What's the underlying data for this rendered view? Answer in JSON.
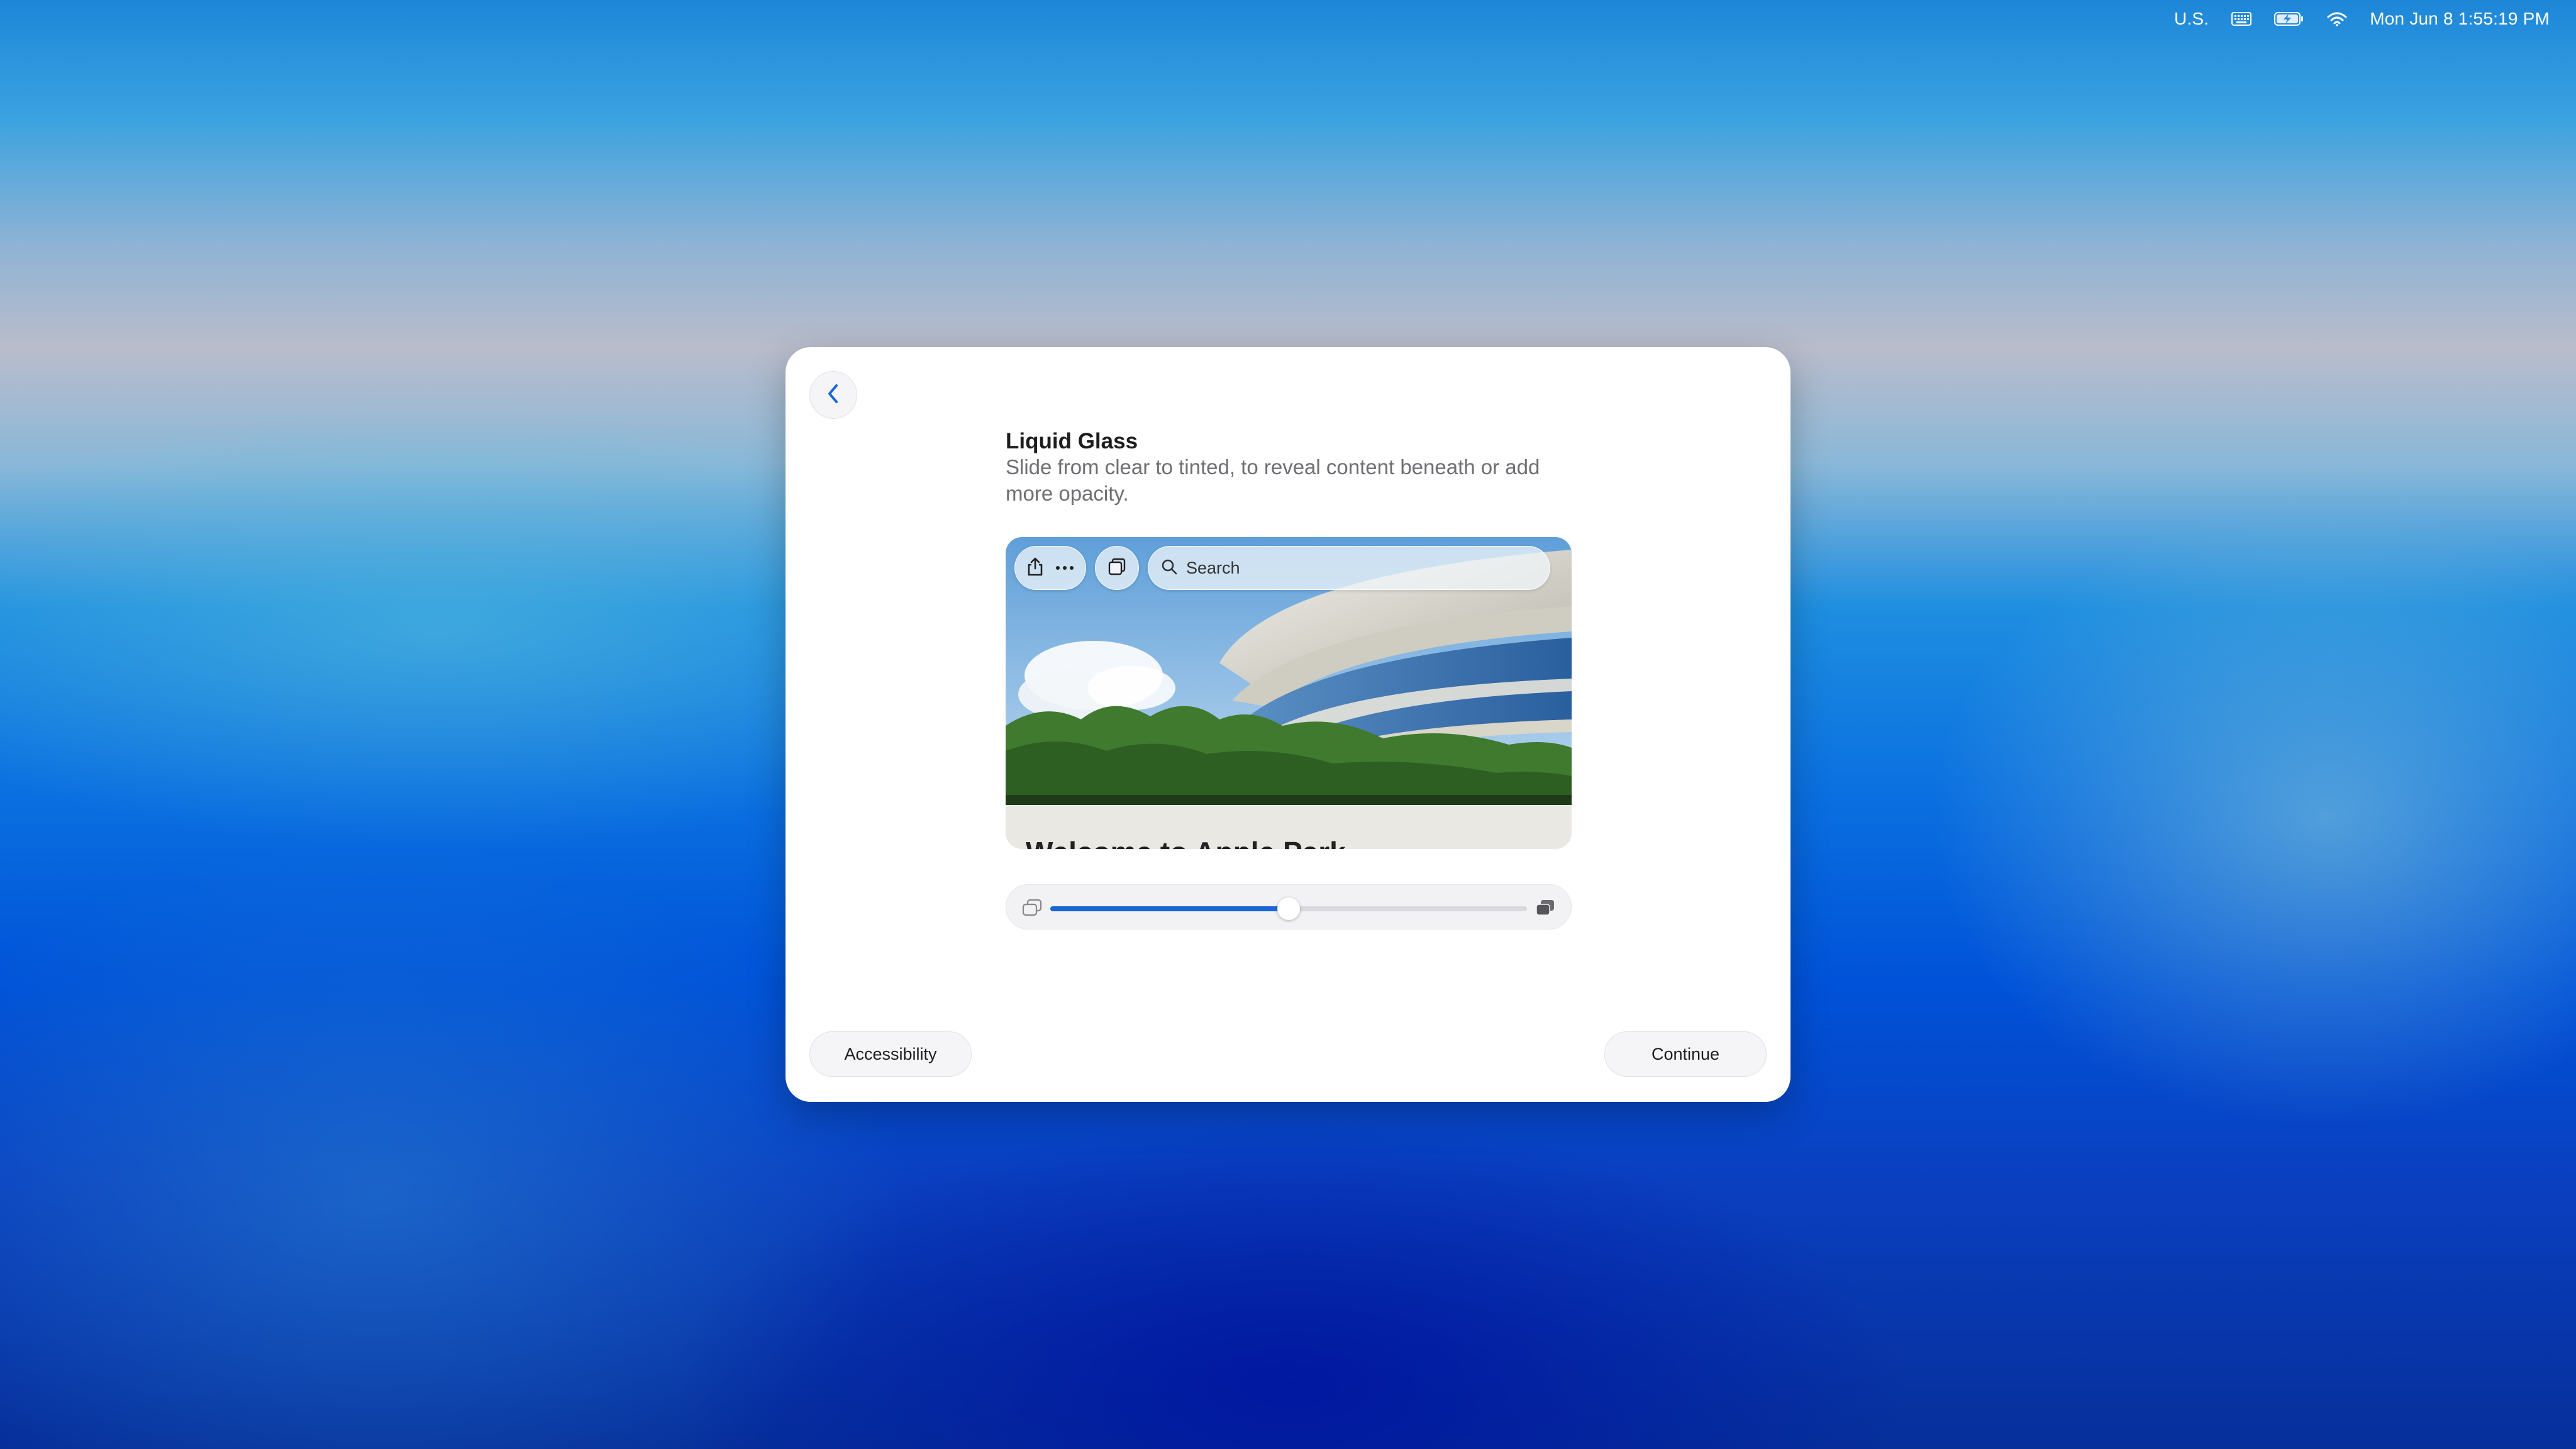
{
  "menubar": {
    "input_source": "U.S.",
    "icons": [
      "keyboard-icon",
      "battery-charging-icon",
      "wifi-icon"
    ],
    "datetime": "Mon Jun 8  1:55:19 PM"
  },
  "dialog": {
    "title": "Liquid Glass",
    "subtitle": "Slide from clear to tinted, to reveal content beneath or add more opacity.",
    "preview": {
      "search_placeholder": "Search",
      "page_heading": "Welcome to Apple Park",
      "toolbar_icons": [
        "share-icon",
        "more-icon",
        "tabs-icon",
        "search-icon"
      ]
    },
    "slider": {
      "value": 0.5,
      "left_icon": "clear-glass-icon",
      "right_icon": "tinted-glass-icon",
      "accent_color": "#1866d6"
    },
    "buttons": {
      "left": "Accessibility",
      "right": "Continue"
    }
  }
}
